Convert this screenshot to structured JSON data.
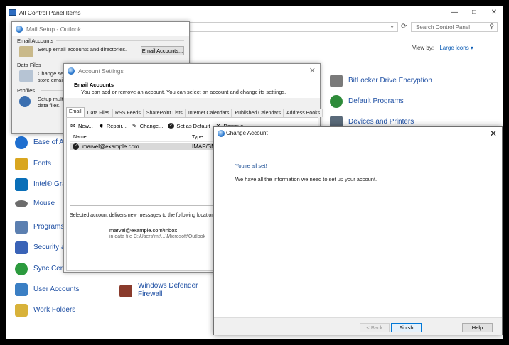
{
  "control_panel": {
    "title": "All Control Panel Items",
    "search_placeholder": "Search Control Panel",
    "view_by_label": "View by:",
    "view_by_value": "Large icons",
    "items_right": [
      {
        "label": "BitLocker Drive Encryption",
        "icon": "bitlocker-icon",
        "color": "#7a7a7a"
      },
      {
        "label": "Default Programs",
        "icon": "default-programs-icon",
        "color": "#2e8b3a"
      },
      {
        "label": "Devices and Printers",
        "icon": "printer-icon",
        "color": "#5a6a7a"
      }
    ],
    "items_left": [
      {
        "label": "Ease of Ac",
        "icon": "ease-of-access-icon",
        "color": "#1f6fd0"
      },
      {
        "label": "Fonts",
        "icon": "fonts-icon",
        "color": "#d9a620"
      },
      {
        "label": "Intel® Gra",
        "icon": "intel-graphics-icon",
        "color": "#0a6fb8"
      },
      {
        "label": "Mouse",
        "icon": "mouse-icon",
        "color": "#6c6c6c"
      },
      {
        "label": "Programs",
        "icon": "programs-icon",
        "color": "#5b7fb0"
      },
      {
        "label": "Security ar",
        "icon": "security-flag-icon",
        "color": "#3a63b7"
      },
      {
        "label": "Sync Cent",
        "icon": "sync-center-icon",
        "color": "#2c9a3e"
      },
      {
        "label": "User Accounts",
        "icon": "user-accounts-icon",
        "color": "#3b7fc4"
      },
      {
        "label": "Work Folders",
        "icon": "work-folders-icon",
        "color": "#d8b23a"
      }
    ],
    "items_mid": [
      {
        "label": "Windows Defender Firewall",
        "icon": "firewall-icon",
        "color": "#8a3b2c"
      }
    ]
  },
  "mail_setup": {
    "title": "Mail Setup - Outlook",
    "email_section": "Email Accounts",
    "email_text": "Setup email accounts and directories.",
    "email_button": "Email Accounts...",
    "data_section": "Data Files",
    "data_text_1": "Change sett",
    "data_text_2": "store email",
    "profiles_section": "Profiles",
    "profiles_text_1": "Setup multi",
    "profiles_text_2": "data files. Ty"
  },
  "account_settings": {
    "title": "Account Settings",
    "header_title": "Email Accounts",
    "header_text": "You can add or remove an account. You can select an account and change its settings.",
    "tabs": [
      "Email",
      "Data Files",
      "RSS Feeds",
      "SharePoint Lists",
      "Internet Calendars",
      "Published Calendars",
      "Address Books"
    ],
    "toolbar": {
      "new": "New...",
      "repair": "Repair...",
      "change": "Change...",
      "set_default": "Set as Default",
      "remove": "Remove"
    },
    "columns": {
      "name": "Name",
      "type": "Type"
    },
    "rows": [
      {
        "name": "marvel@example.com",
        "type": "IMAP/SMT"
      }
    ],
    "deliver_text": "Selected account delivers new messages to the following location:",
    "inbox_path": "marvel@example.com\\Inbox",
    "data_file_text": "in data file C:\\Users\\mt\\...\\Microsoft\\Outlook"
  },
  "change_account": {
    "title": "Change Account",
    "all_set": "You're all set!",
    "info": "We have all the information we need to set up your account.",
    "back": "< Back",
    "finish": "Finish",
    "help": "Help"
  }
}
